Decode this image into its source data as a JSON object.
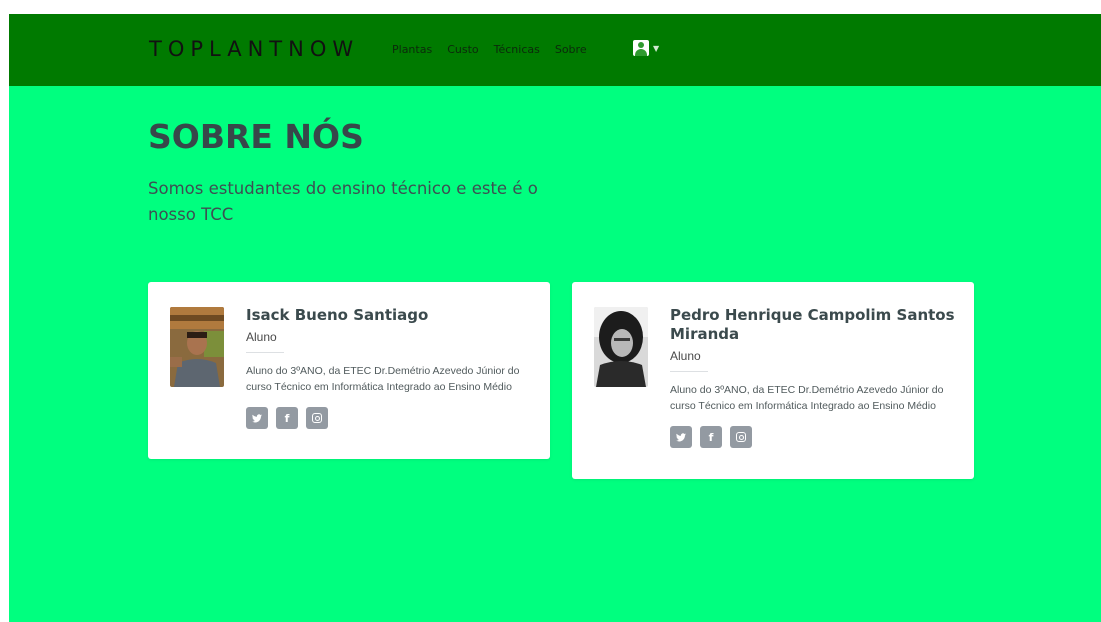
{
  "navbar": {
    "brand": "TOPLANTNOW",
    "links": [
      {
        "label": "Plantas"
      },
      {
        "label": "Custo"
      },
      {
        "label": "Técnicas"
      },
      {
        "label": "Sobre"
      }
    ],
    "user_icon": "user-icon",
    "dropdown_icon": "chevron-down-icon"
  },
  "hero": {
    "title": "SOBRE NÓS",
    "subtitle": "Somos estudantes do ensino técnico e este é o nosso TCC"
  },
  "members": [
    {
      "name": "Isack Bueno Santiago",
      "role": "Aluno",
      "description": "Aluno do 3ºANO, da ETEC Dr.Demétrio Azevedo Júnior do curso Técnico em Informática Integrado ao Ensino Médio",
      "social_icons": [
        "twitter-icon",
        "facebook-icon",
        "instagram-icon"
      ]
    },
    {
      "name": "Pedro Henrique Campolim Santos Miranda",
      "role": "Aluno",
      "description": "Aluno do 3ºANO, da ETEC Dr.Demétrio Azevedo Júnior do curso Técnico em Informática Integrado ao Ensino Médio",
      "social_icons": [
        "twitter-icon",
        "facebook-icon",
        "instagram-icon"
      ]
    }
  ],
  "colors": {
    "navbar": "#007a00",
    "background": "#00ff7f",
    "card": "#ffffff",
    "social_button": "#939aa2",
    "heading": "#37474a"
  }
}
